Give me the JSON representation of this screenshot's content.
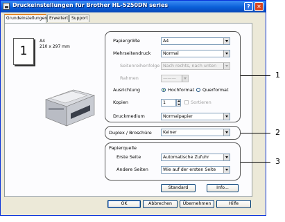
{
  "window": {
    "title": "Druckeinstellungen für Brother HL-5250DN series",
    "help_label": "?",
    "close_label": "✕"
  },
  "tabs": [
    {
      "label": "Grundeinstellungen",
      "active": true
    },
    {
      "label": "Erweitert"
    },
    {
      "label": "Support"
    }
  ],
  "preview": {
    "page_number": "1",
    "paper_name": "A4",
    "paper_size": "210 x 297 mm"
  },
  "settings": {
    "papiergroesse": {
      "label": "Papiergröße",
      "value": "A4"
    },
    "mehrseitendruck": {
      "label": "Mehrseitendruck",
      "value": "Normal"
    },
    "seitenreihenfolge": {
      "label": "Seitenreihenfolge",
      "value": "Nach rechts, nach unten"
    },
    "rahmen": {
      "label": "Rahmen",
      "value": "———"
    },
    "ausrichtung": {
      "label": "Ausrichtung",
      "option1": "Hochformat",
      "option2": "Querformat",
      "selected": "Hochformat"
    },
    "kopien": {
      "label": "Kopien",
      "value": "1",
      "sortieren_label": "Sortieren"
    },
    "druckmedium": {
      "label": "Druckmedium",
      "value": "Normalpapier"
    }
  },
  "duplex": {
    "label": "Duplex / Broschüre",
    "value": "Keiner"
  },
  "papierquelle": {
    "title": "Papierquelle",
    "erste_seite": {
      "label": "Erste Seite",
      "value": "Automatische Zufuhr"
    },
    "andere_seiten": {
      "label": "Andere Seiten",
      "value": "Wie auf der ersten Seite"
    }
  },
  "buttons": {
    "standard": "Standard",
    "info": "Info...",
    "ok": "OK",
    "abbrechen": "Abbrechen",
    "uebernehmen": "Übernehmen",
    "hilfe": "Hilfe"
  },
  "callouts": [
    "1",
    "2",
    "3"
  ]
}
